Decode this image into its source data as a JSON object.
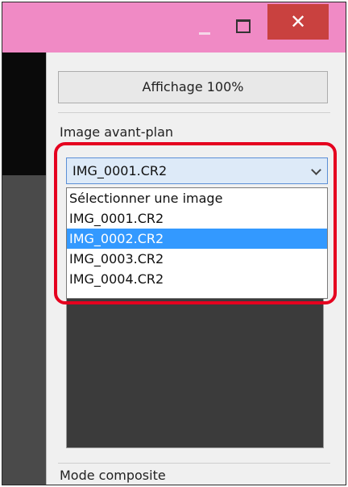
{
  "window": {
    "close_glyph": "✕"
  },
  "panel": {
    "display_button": "Affichage 100%",
    "foreground_label": "Image avant-plan",
    "selected_image": "IMG_0001.CR2",
    "dropdown_items": [
      "Sélectionner une image",
      "IMG_0001.CR2",
      "IMG_0002.CR2",
      "IMG_0003.CR2",
      "IMG_0004.CR2"
    ],
    "highlighted_item": "IMG_0002.CR2",
    "composite_label": "Mode composite"
  },
  "colors": {
    "titlebar": "#f08ac5",
    "close": "#c9413f",
    "selection": "#3399ff",
    "callout": "#e5001f"
  }
}
